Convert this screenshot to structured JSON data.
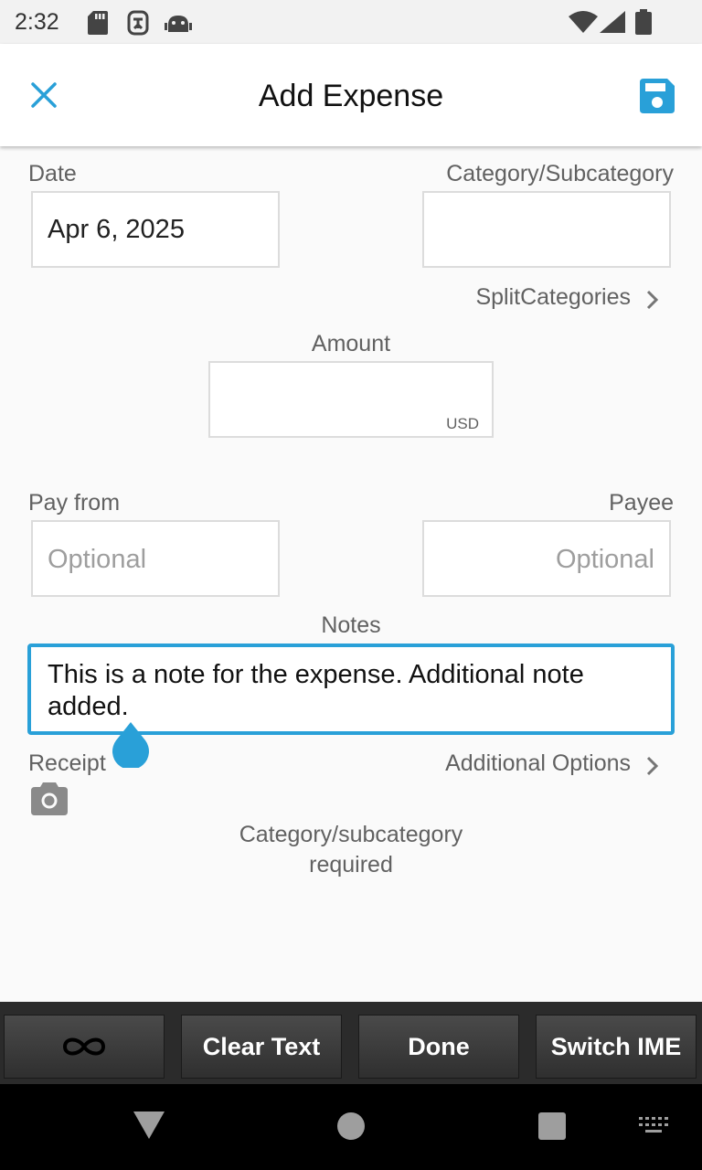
{
  "status_bar": {
    "time": "2:32",
    "left_icons": [
      "sd-card-icon",
      "accessibility-icon",
      "android-icon"
    ],
    "right_icons": [
      "wifi-icon",
      "signal-icon",
      "battery-icon"
    ]
  },
  "app_bar": {
    "title": "Add Expense",
    "close_icon": "close-icon",
    "save_icon": "save-icon",
    "accent_color": "#29a0d8"
  },
  "form": {
    "date": {
      "label": "Date",
      "value": "Apr 6, 2025"
    },
    "category": {
      "label": "Category/Subcategory",
      "value": ""
    },
    "split_categories": {
      "label": "SplitCategories"
    },
    "amount": {
      "label": "Amount",
      "value": "",
      "currency": "USD"
    },
    "pay_from": {
      "label": "Pay from",
      "placeholder": "Optional"
    },
    "payee": {
      "label": "Payee",
      "placeholder": "Optional"
    },
    "notes": {
      "label": "Notes",
      "value": "This is a note for the expense. Additional note added."
    },
    "receipt": {
      "label": "Receipt",
      "icon": "camera-icon"
    },
    "additional_options": {
      "label": "Additional Options"
    },
    "validation_message": "Category/subcategory required"
  },
  "keyboard_bar": {
    "keys": [
      "∞",
      "Clear Text",
      "Done",
      "Switch IME"
    ]
  },
  "nav_bar": {
    "icons": [
      "back-icon",
      "home-icon",
      "recents-icon",
      "keyboard-icon"
    ]
  }
}
